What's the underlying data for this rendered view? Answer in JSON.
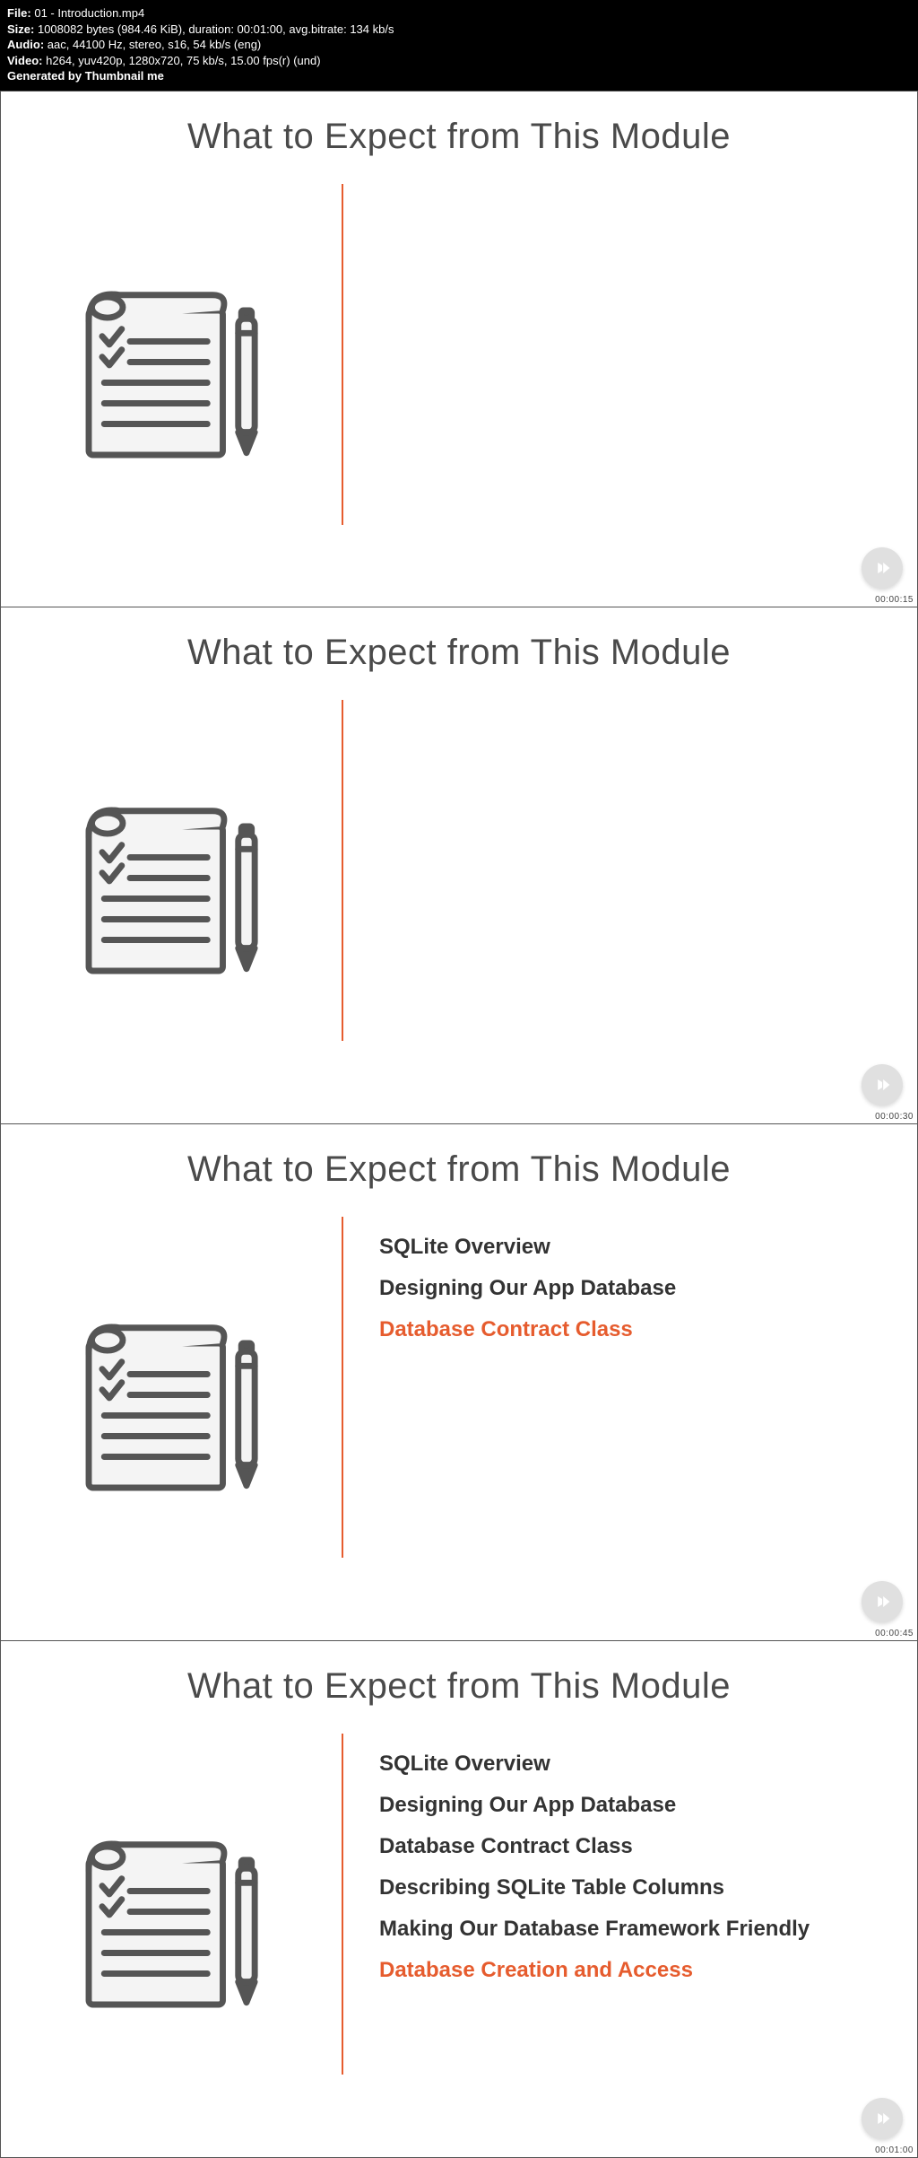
{
  "meta": {
    "file_label": "File:",
    "file_value": "01 - Introduction.mp4",
    "size_label": "Size:",
    "size_value": "1008082 bytes (984.46 KiB), duration: 00:01:00, avg.bitrate: 134 kb/s",
    "audio_label": "Audio:",
    "audio_value": "aac, 44100 Hz, stereo, s16, 54 kb/s (eng)",
    "video_label": "Video:",
    "video_value": "h264, yuv420p, 1280x720, 75 kb/s, 15.00 fps(r) (und)",
    "generated": "Generated by Thumbnail me"
  },
  "frames": [
    {
      "title": "What to Expect from This Module",
      "timestamp": "00:00:15",
      "bullets": [],
      "highlight_index": -1
    },
    {
      "title": "What to Expect from This Module",
      "timestamp": "00:00:30",
      "bullets": [],
      "highlight_index": -1
    },
    {
      "title": "What to Expect from This Module",
      "timestamp": "00:00:45",
      "bullets": [
        "SQLite Overview",
        "Designing Our App Database",
        "Database Contract Class"
      ],
      "highlight_index": 2
    },
    {
      "title": "What to Expect from This Module",
      "timestamp": "00:01:00",
      "bullets": [
        "SQLite Overview",
        "Designing Our App Database",
        "Database Contract Class",
        "Describing SQLite Table Columns",
        "Making Our Database Framework Friendly",
        "Database Creation and Access"
      ],
      "highlight_index": 5
    }
  ],
  "icons": {
    "notepad": "notepad-checklist-icon",
    "play": "play-icon"
  }
}
